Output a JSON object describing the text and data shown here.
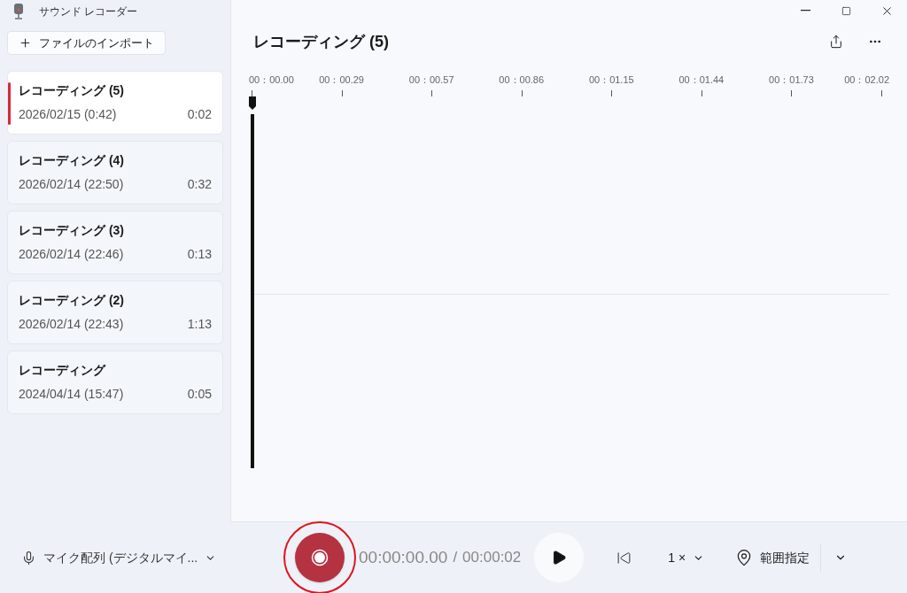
{
  "window": {
    "title": "サウンド レコーダー"
  },
  "import_button": {
    "label": "ファイルのインポート"
  },
  "recordings": [
    {
      "name": "レコーディング (5)",
      "date": "2026/02/15 (0:42)",
      "duration": "0:02",
      "selected": true
    },
    {
      "name": "レコーディング (4)",
      "date": "2026/02/14 (22:50)",
      "duration": "0:32",
      "selected": false
    },
    {
      "name": "レコーディング (3)",
      "date": "2026/02/14 (22:46)",
      "duration": "0:13",
      "selected": false
    },
    {
      "name": "レコーディング (2)",
      "date": "2026/02/14 (22:43)",
      "duration": "1:13",
      "selected": false
    },
    {
      "name": "レコーディング",
      "date": "2024/04/14 (15:47)",
      "duration": "0:05",
      "selected": false
    }
  ],
  "editor": {
    "title": "レコーディング (5)",
    "timeline_labels": [
      "00：00.00",
      "00：00.29",
      "00：00.57",
      "00：00.86",
      "00：01.15",
      "00：01.44",
      "00：01.73",
      "00：02.02"
    ]
  },
  "bottom_bar": {
    "microphone": "マイク配列 (デジタルマイ...",
    "elapsed": "00:00:00.00",
    "separator": "/",
    "total": "00:00:02",
    "speed": "1 ×",
    "range": "範囲指定"
  }
}
